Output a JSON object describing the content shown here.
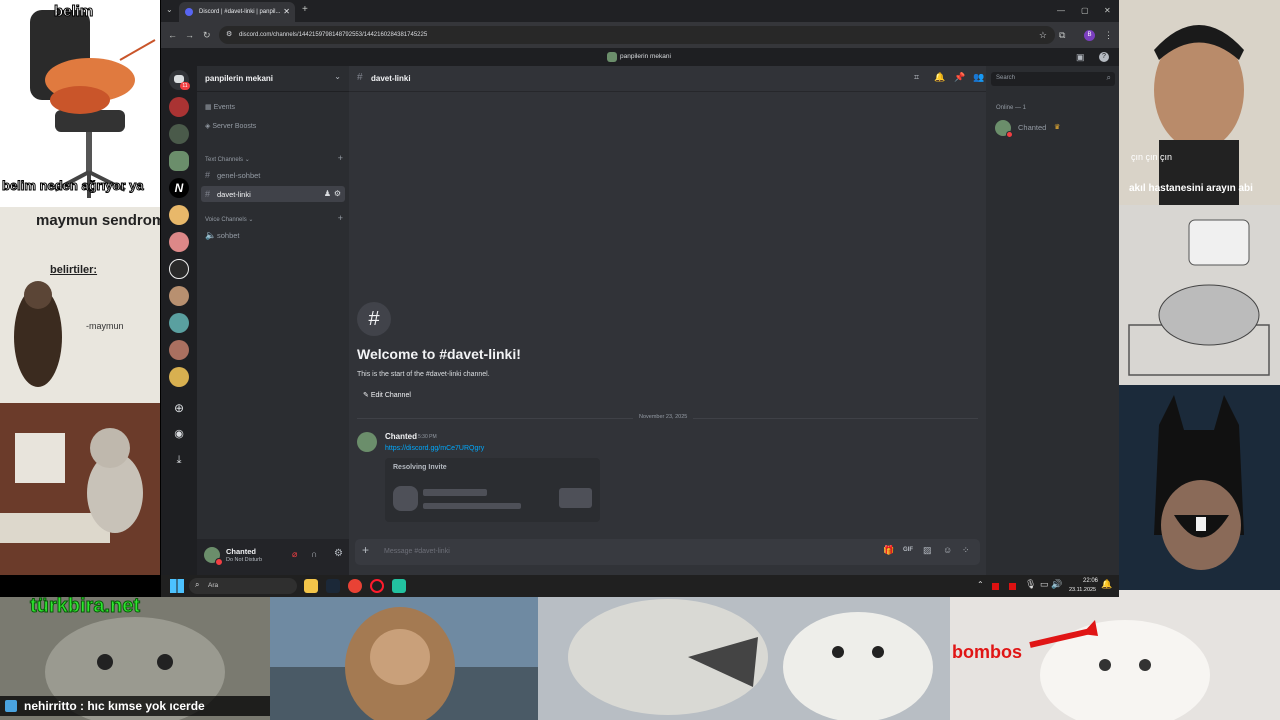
{
  "overlays": {
    "top_left_caption_1": "belim",
    "top_left_caption_2": "belim neden ağrıyor ya",
    "monkey_title": "maymun sendromu",
    "monkey_symptoms": "belirtiler:",
    "monkey_signature": "-maymun",
    "webcam_caption_1": "çın çın çın",
    "webcam_caption_2": "akıl hastanesini arayın abi",
    "cat_overlay_text": "türkbira.net",
    "chat_ticker": "nehirritto : hıc kımse yok ıcerde",
    "bombos_text": "bombos"
  },
  "browser": {
    "tab_title": "Discord | #davet-linki | panpil...",
    "url": "discord.com/channels/1442159798148792553/1442160284381745225",
    "profile_initial": "B"
  },
  "discord": {
    "top_server_name": "panpilerin mekani",
    "server_name": "panpilerin mekani",
    "unread_badge": "11",
    "sidebar": {
      "events": "Events",
      "server_boosts": "Server Boosts",
      "text_category": "Text Channels",
      "text_channels": [
        "genel-sohbet",
        "davet-linki"
      ],
      "voice_category": "Voice Channels",
      "voice_channels": [
        "sohbet"
      ]
    },
    "header": {
      "channel": "davet-linki",
      "search_placeholder": "Search"
    },
    "welcome": {
      "title": "Welcome to #davet-linki!",
      "subtitle": "This is the start of the #davet-linki channel.",
      "edit_button": "Edit Channel"
    },
    "date_divider": "November 23, 2025",
    "message": {
      "author": "Chanted",
      "time": "5:30 PM",
      "link": "https://discord.gg/mCe7URQgry",
      "embed_title": "Resolving Invite"
    },
    "composer_placeholder": "Message #davet-linki",
    "members": {
      "online_header": "Online — 1",
      "list": [
        "Chanted"
      ]
    },
    "user_panel": {
      "name": "Chanted",
      "status": "Do Not Disturb"
    },
    "colors": {
      "link": "#00a8fc",
      "bg_main": "#313338",
      "bg_sidebar": "#2b2d31",
      "bg_dark": "#1e1f22",
      "dnd": "#f23f43"
    }
  },
  "taskbar": {
    "search_label": "Ara",
    "time": "22:06",
    "date": "23.11.2025"
  }
}
